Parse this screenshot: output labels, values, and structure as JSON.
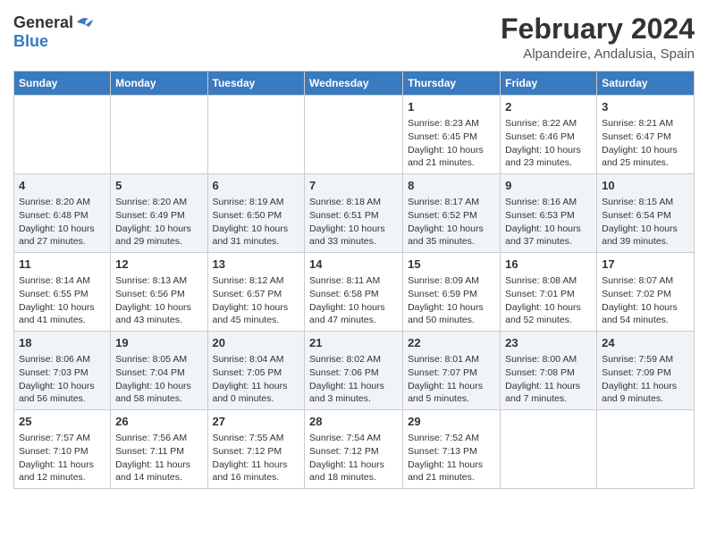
{
  "logo": {
    "line1": "General",
    "line2": "Blue"
  },
  "title": "February 2024",
  "subtitle": "Alpandeire, Andalusia, Spain",
  "days_of_week": [
    "Sunday",
    "Monday",
    "Tuesday",
    "Wednesday",
    "Thursday",
    "Friday",
    "Saturday"
  ],
  "weeks": [
    [
      {
        "day": "",
        "content": ""
      },
      {
        "day": "",
        "content": ""
      },
      {
        "day": "",
        "content": ""
      },
      {
        "day": "",
        "content": ""
      },
      {
        "day": "1",
        "content": "Sunrise: 8:23 AM\nSunset: 6:45 PM\nDaylight: 10 hours and 21 minutes."
      },
      {
        "day": "2",
        "content": "Sunrise: 8:22 AM\nSunset: 6:46 PM\nDaylight: 10 hours and 23 minutes."
      },
      {
        "day": "3",
        "content": "Sunrise: 8:21 AM\nSunset: 6:47 PM\nDaylight: 10 hours and 25 minutes."
      }
    ],
    [
      {
        "day": "4",
        "content": "Sunrise: 8:20 AM\nSunset: 6:48 PM\nDaylight: 10 hours and 27 minutes."
      },
      {
        "day": "5",
        "content": "Sunrise: 8:20 AM\nSunset: 6:49 PM\nDaylight: 10 hours and 29 minutes."
      },
      {
        "day": "6",
        "content": "Sunrise: 8:19 AM\nSunset: 6:50 PM\nDaylight: 10 hours and 31 minutes."
      },
      {
        "day": "7",
        "content": "Sunrise: 8:18 AM\nSunset: 6:51 PM\nDaylight: 10 hours and 33 minutes."
      },
      {
        "day": "8",
        "content": "Sunrise: 8:17 AM\nSunset: 6:52 PM\nDaylight: 10 hours and 35 minutes."
      },
      {
        "day": "9",
        "content": "Sunrise: 8:16 AM\nSunset: 6:53 PM\nDaylight: 10 hours and 37 minutes."
      },
      {
        "day": "10",
        "content": "Sunrise: 8:15 AM\nSunset: 6:54 PM\nDaylight: 10 hours and 39 minutes."
      }
    ],
    [
      {
        "day": "11",
        "content": "Sunrise: 8:14 AM\nSunset: 6:55 PM\nDaylight: 10 hours and 41 minutes."
      },
      {
        "day": "12",
        "content": "Sunrise: 8:13 AM\nSunset: 6:56 PM\nDaylight: 10 hours and 43 minutes."
      },
      {
        "day": "13",
        "content": "Sunrise: 8:12 AM\nSunset: 6:57 PM\nDaylight: 10 hours and 45 minutes."
      },
      {
        "day": "14",
        "content": "Sunrise: 8:11 AM\nSunset: 6:58 PM\nDaylight: 10 hours and 47 minutes."
      },
      {
        "day": "15",
        "content": "Sunrise: 8:09 AM\nSunset: 6:59 PM\nDaylight: 10 hours and 50 minutes."
      },
      {
        "day": "16",
        "content": "Sunrise: 8:08 AM\nSunset: 7:01 PM\nDaylight: 10 hours and 52 minutes."
      },
      {
        "day": "17",
        "content": "Sunrise: 8:07 AM\nSunset: 7:02 PM\nDaylight: 10 hours and 54 minutes."
      }
    ],
    [
      {
        "day": "18",
        "content": "Sunrise: 8:06 AM\nSunset: 7:03 PM\nDaylight: 10 hours and 56 minutes."
      },
      {
        "day": "19",
        "content": "Sunrise: 8:05 AM\nSunset: 7:04 PM\nDaylight: 10 hours and 58 minutes."
      },
      {
        "day": "20",
        "content": "Sunrise: 8:04 AM\nSunset: 7:05 PM\nDaylight: 11 hours and 0 minutes."
      },
      {
        "day": "21",
        "content": "Sunrise: 8:02 AM\nSunset: 7:06 PM\nDaylight: 11 hours and 3 minutes."
      },
      {
        "day": "22",
        "content": "Sunrise: 8:01 AM\nSunset: 7:07 PM\nDaylight: 11 hours and 5 minutes."
      },
      {
        "day": "23",
        "content": "Sunrise: 8:00 AM\nSunset: 7:08 PM\nDaylight: 11 hours and 7 minutes."
      },
      {
        "day": "24",
        "content": "Sunrise: 7:59 AM\nSunset: 7:09 PM\nDaylight: 11 hours and 9 minutes."
      }
    ],
    [
      {
        "day": "25",
        "content": "Sunrise: 7:57 AM\nSunset: 7:10 PM\nDaylight: 11 hours and 12 minutes."
      },
      {
        "day": "26",
        "content": "Sunrise: 7:56 AM\nSunset: 7:11 PM\nDaylight: 11 hours and 14 minutes."
      },
      {
        "day": "27",
        "content": "Sunrise: 7:55 AM\nSunset: 7:12 PM\nDaylight: 11 hours and 16 minutes."
      },
      {
        "day": "28",
        "content": "Sunrise: 7:54 AM\nSunset: 7:12 PM\nDaylight: 11 hours and 18 minutes."
      },
      {
        "day": "29",
        "content": "Sunrise: 7:52 AM\nSunset: 7:13 PM\nDaylight: 11 hours and 21 minutes."
      },
      {
        "day": "",
        "content": ""
      },
      {
        "day": "",
        "content": ""
      }
    ]
  ]
}
